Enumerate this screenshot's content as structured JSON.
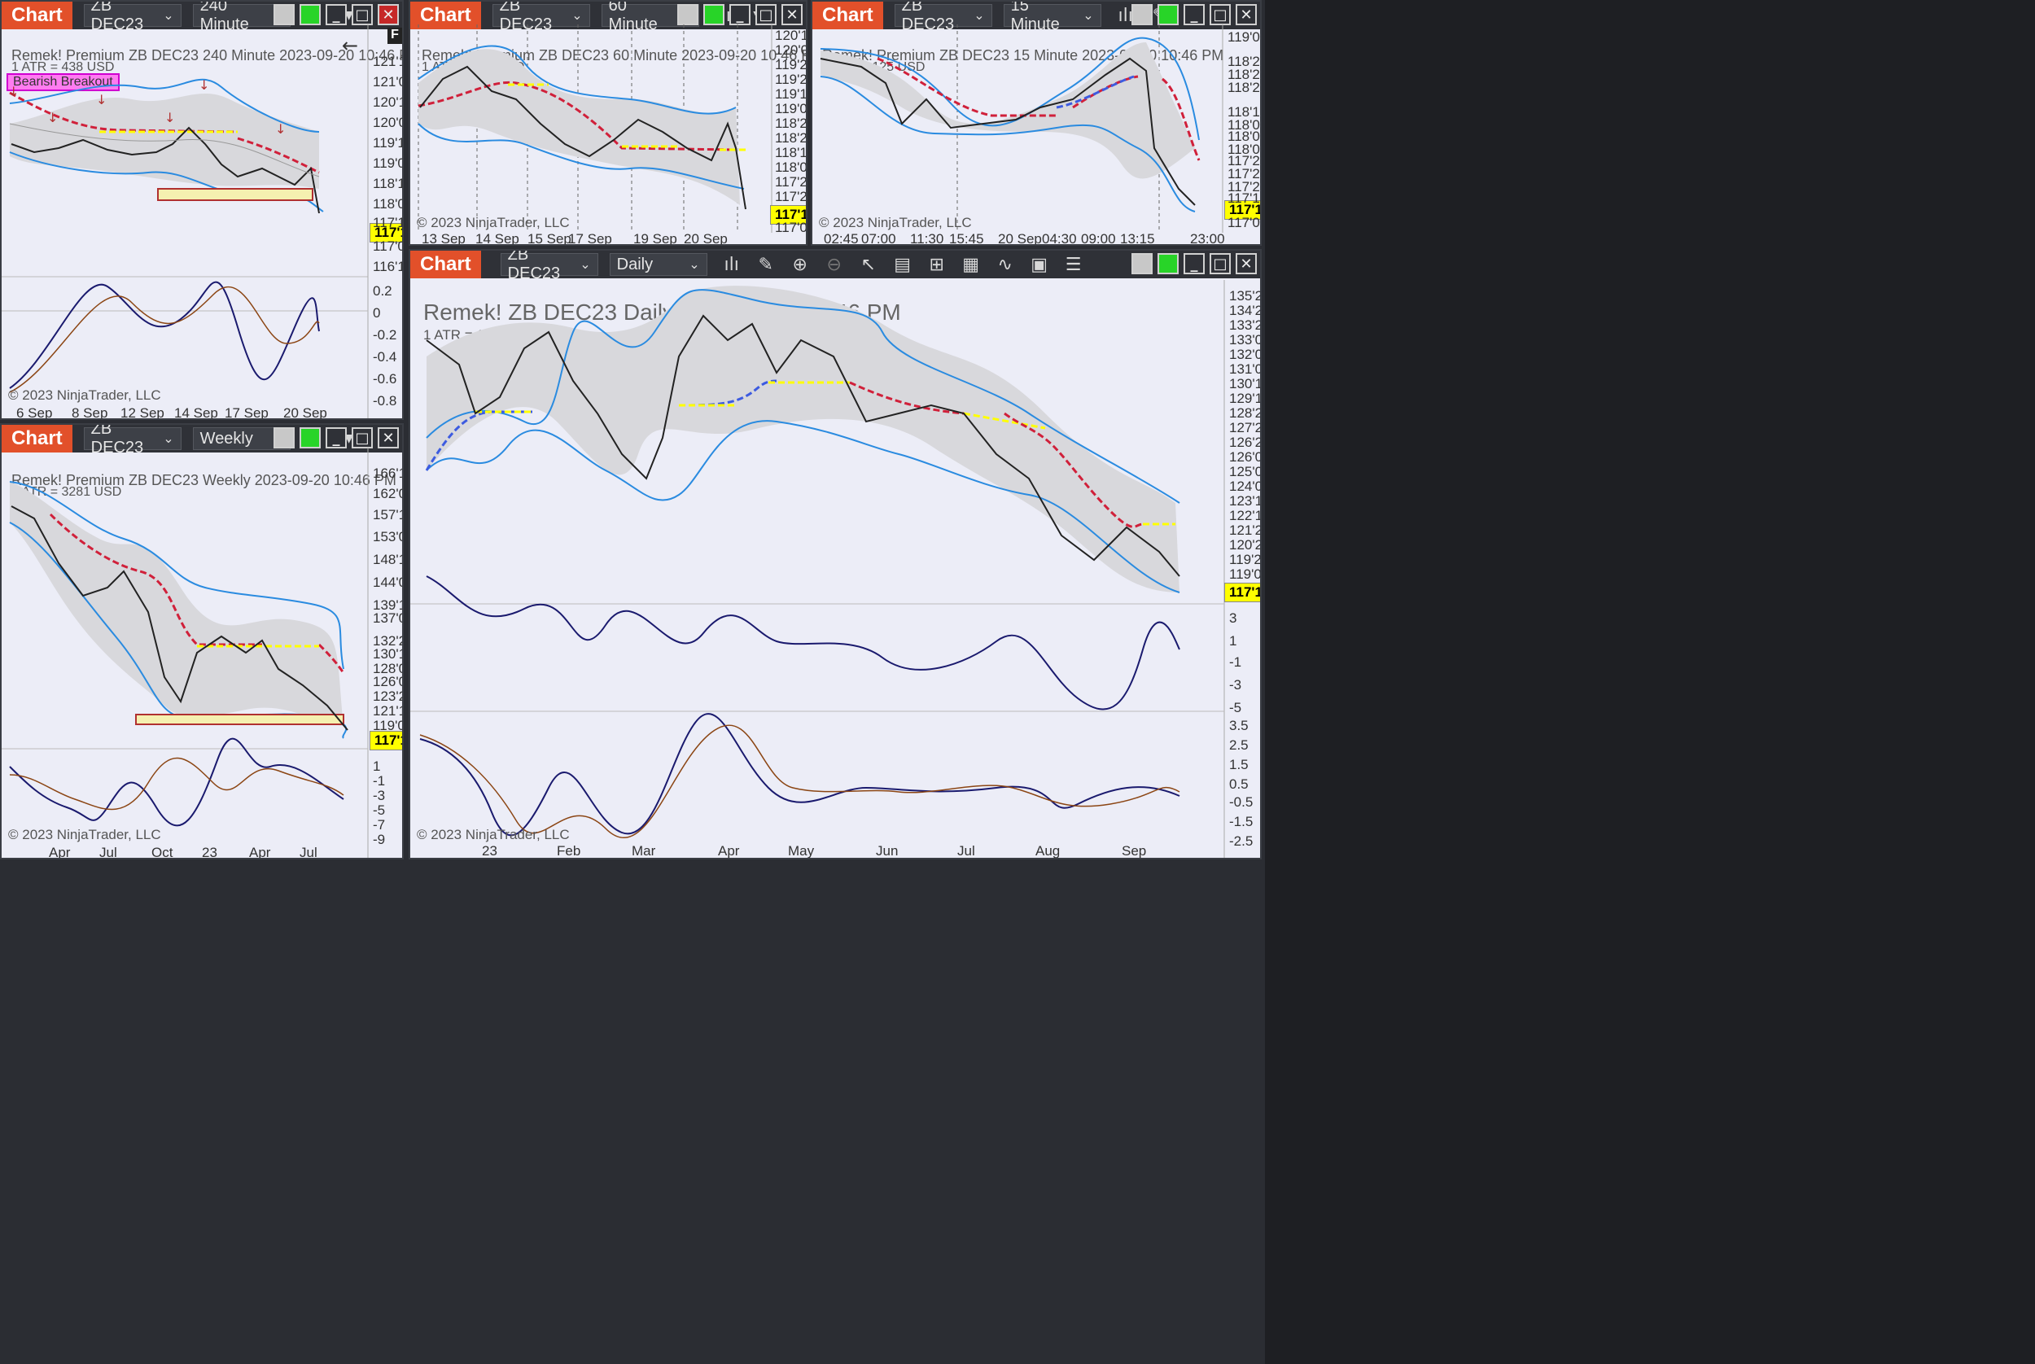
{
  "app_label": "Chart",
  "instrument": "ZB DEC23",
  "colors": {
    "accent": "#e2502a",
    "chart_bg": "#ecedf7",
    "band": "#1e90ff",
    "bear": "#8b0000",
    "bull": "#006400",
    "yellow": "#ffff00"
  },
  "panels": {
    "p240": {
      "interval": "240 Minute",
      "title": "Remek!  Premium  ZB DEC23  240 Minute  2023-09-20 10:46 PM",
      "atr": "1 ATR = 438 USD",
      "label": "Bearish Breakout",
      "letter": "F",
      "copyright": "© 2023 NinjaTrader, LLC",
      "price_tag": "117'12",
      "yaxis": [
        "121'16",
        "121'00",
        "120'16",
        "120'00",
        "119'16",
        "119'00",
        "118'16",
        "118'00",
        "117'16",
        "117'00",
        "116'16"
      ],
      "osc_axis": [
        "0.2",
        "0",
        "-0.2",
        "-0.4",
        "-0.6",
        "-0.8"
      ],
      "xaxis": [
        "6 Sep",
        "8 Sep",
        "12 Sep",
        "14 Sep",
        "17 Sep",
        "20 Sep"
      ]
    },
    "p60": {
      "interval": "60 Minute",
      "title": "Remek!  Premium  ZB DEC23  60 Minute  2023-09-20 10:46 PM",
      "atr": "1 ATR = 219 USD",
      "copyright": "© 2023 NinjaTrader, LLC",
      "price_tag": "117'12",
      "yaxis": [
        "120'12",
        "120'04",
        "119'28",
        "119'20",
        "119'12",
        "119'04",
        "118'28",
        "118'20",
        "118'12",
        "118'04",
        "117'28",
        "117'20",
        "117'04"
      ],
      "xaxis": [
        "13 Sep",
        "14 Sep",
        "15 Sep",
        "17 Sep",
        "19 Sep",
        "20 Sep"
      ]
    },
    "p15": {
      "interval": "15 Minute",
      "title": "Remek!  Premium  ZB DEC23  15 Minute  2023-09-20 10:46 PM",
      "atr": "1 ATR = 125 USD",
      "copyright": "© 2023 NinjaTrader, LLC",
      "price_tag": "117'12",
      "yaxis": [
        "119'04",
        "118'28",
        "118'24",
        "118'20",
        "118'12",
        "118'08",
        "118'04",
        "118'00",
        "117'28",
        "117'24",
        "117'20",
        "117'16",
        "117'08"
      ],
      "xaxis": [
        "02:45",
        "07:00",
        "11:30",
        "15:45",
        "20 Sep",
        "04:30",
        "09:00",
        "13:15",
        "23:00"
      ]
    },
    "pweekly": {
      "interval": "Weekly",
      "title": "Remek!  Premium  ZB DEC23  Weekly  2023-09-20 10:46 PM",
      "atr": "1 ATR = 3281 USD",
      "copyright": "© 2023 NinjaTrader, LLC",
      "price_tag": "117'12",
      "yaxis": [
        "166'16",
        "162'00",
        "157'16",
        "153'00",
        "148'16",
        "144'00",
        "139'16",
        "137'08",
        "132'24",
        "130'16",
        "128'08",
        "126'00",
        "123'24",
        "121'16",
        "119'08"
      ],
      "osc_axis": [
        "1",
        "-1",
        "-3",
        "-5",
        "-7",
        "-9"
      ],
      "xaxis": [
        "Apr",
        "Jul",
        "Oct",
        "23",
        "Apr",
        "Jul"
      ]
    },
    "pdaily": {
      "interval": "Daily",
      "title": "Remek!  ZB DEC23  Daily  2023-09-20 10:46 PM",
      "atr": "1 ATR = 1156 USD",
      "copyright": "© 2023 NinjaTrader, LLC",
      "price_tag": "117'12",
      "yaxis": [
        "135'20",
        "134'24",
        "133'28",
        "133'00",
        "132'04",
        "131'08",
        "130'12",
        "129'16",
        "128'20",
        "127'24",
        "126'28",
        "126'00",
        "125'04",
        "124'08",
        "123'12",
        "122'16",
        "121'20",
        "120'24",
        "119'28",
        "119'00",
        "118'04"
      ],
      "hist_axis": [
        "3",
        "1",
        "-1",
        "-3",
        "-5"
      ],
      "osc_axis": [
        "3.5",
        "2.5",
        "1.5",
        "0.5",
        "-0.5",
        "-1.5",
        "-2.5"
      ],
      "xaxis": [
        "23",
        "Feb",
        "Mar",
        "Apr",
        "May",
        "Jun",
        "Jul",
        "Aug",
        "Sep"
      ]
    }
  }
}
